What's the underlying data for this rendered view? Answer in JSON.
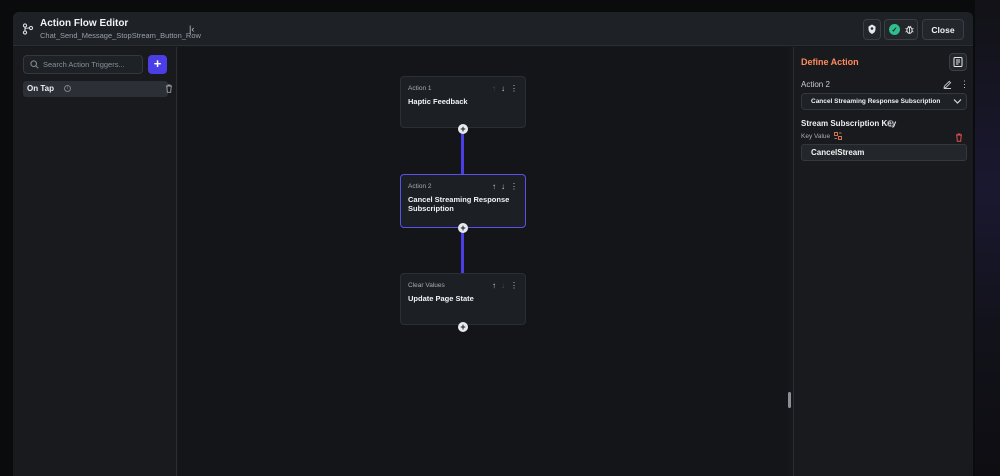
{
  "header": {
    "title": "Action Flow Editor",
    "subtitle": "Chat_Send_Message_StopStream_Button_Row",
    "close_label": "Close",
    "icons": {
      "flow": "flow-icon",
      "collapse": "collapse-panel-icon",
      "share": "share-icon",
      "status": "check-circle-icon",
      "debug": "bug-icon"
    }
  },
  "triggers": {
    "search_placeholder": "Search Action Triggers...",
    "add_icon": "plus-icon",
    "items": [
      {
        "label": "On Tap"
      }
    ]
  },
  "flow": {
    "nodes": [
      {
        "caption": "Action 1",
        "title": "Haptic Feedback",
        "up_enabled": false,
        "down_enabled": true,
        "selected": false
      },
      {
        "caption": "Action 2",
        "title": "Cancel Streaming Response Subscription",
        "up_enabled": true,
        "down_enabled": true,
        "selected": true
      },
      {
        "caption": "Clear Values",
        "title": "Update Page State",
        "up_enabled": true,
        "down_enabled": false,
        "selected": false
      }
    ],
    "accent_color": "#4b3ee6"
  },
  "define_action": {
    "title": "Define Action",
    "action_name": "Action 2",
    "action_type": "Cancel Streaming Response Subscription",
    "key_section_title": "Stream Subscription Key",
    "key_label": "Key Value",
    "key_value": "CancelStream",
    "title_color": "#ff8a5c"
  }
}
